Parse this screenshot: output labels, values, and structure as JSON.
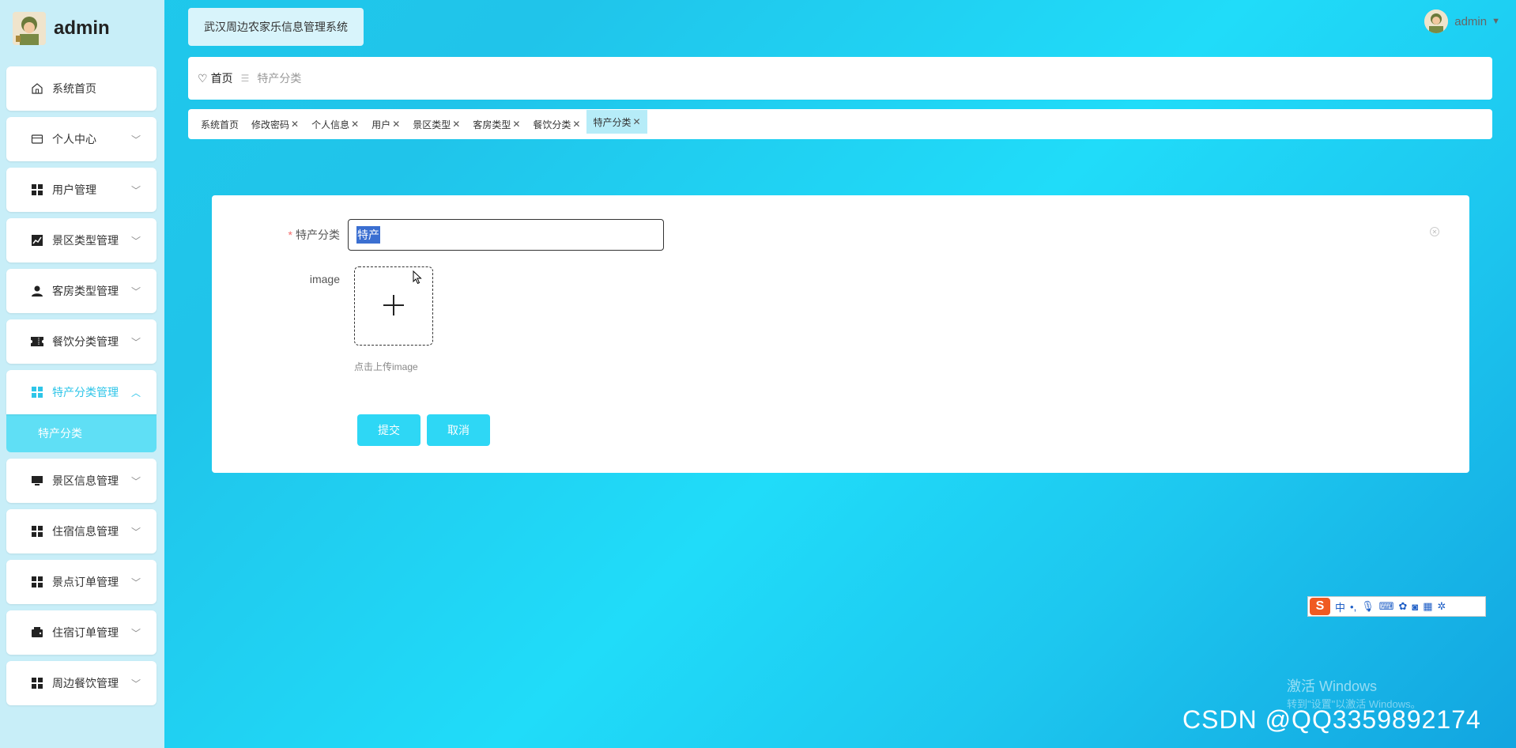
{
  "brand": {
    "name": "admin"
  },
  "sidebar": {
    "items": [
      {
        "label": "系统首页",
        "icon": "home-icon"
      },
      {
        "label": "个人中心",
        "icon": "card-icon"
      },
      {
        "label": "用户管理",
        "icon": "grid-icon"
      },
      {
        "label": "景区类型管理",
        "icon": "chart-icon"
      },
      {
        "label": "客房类型管理",
        "icon": "person-icon"
      },
      {
        "label": "餐饮分类管理",
        "icon": "ticket-icon"
      },
      {
        "label": "特产分类管理",
        "icon": "grid-icon",
        "expanded": true
      },
      {
        "label": "景区信息管理",
        "icon": "monitor-icon"
      },
      {
        "label": "住宿信息管理",
        "icon": "grid-icon"
      },
      {
        "label": "景点订单管理",
        "icon": "grid-icon"
      },
      {
        "label": "住宿订单管理",
        "icon": "wallet-icon"
      },
      {
        "label": "周边餐饮管理",
        "icon": "grid-icon"
      }
    ],
    "submenu_active": "特产分类"
  },
  "header": {
    "system_title": "武汉周边农家乐信息管理系统",
    "user_name": "admin"
  },
  "breadcrumb": {
    "home": "首页",
    "current": "特产分类"
  },
  "tags": [
    {
      "label": "系统首页",
      "closable": false
    },
    {
      "label": "修改密码",
      "closable": true
    },
    {
      "label": "个人信息",
      "closable": true
    },
    {
      "label": "用户",
      "closable": true
    },
    {
      "label": "景区类型",
      "closable": true
    },
    {
      "label": "客房类型",
      "closable": true
    },
    {
      "label": "餐饮分类",
      "closable": true
    },
    {
      "label": "特产分类",
      "closable": true,
      "active": true
    }
  ],
  "form": {
    "category_label": "特产分类",
    "category_value": "特产",
    "image_label": "image",
    "upload_tip": "点击上传image",
    "submit_label": "提交",
    "cancel_label": "取消"
  },
  "ime": {
    "mode": "中",
    "punct": "•,"
  },
  "overlay": {
    "activate_title": "激活 Windows",
    "activate_sub": "转到\"设置\"以激活 Windows。",
    "csdn": "CSDN @QQ3359892174"
  },
  "colors": {
    "accent": "#2ed7f5",
    "sidebar_bg": "#c8eef8",
    "required": "#f56c6c"
  }
}
